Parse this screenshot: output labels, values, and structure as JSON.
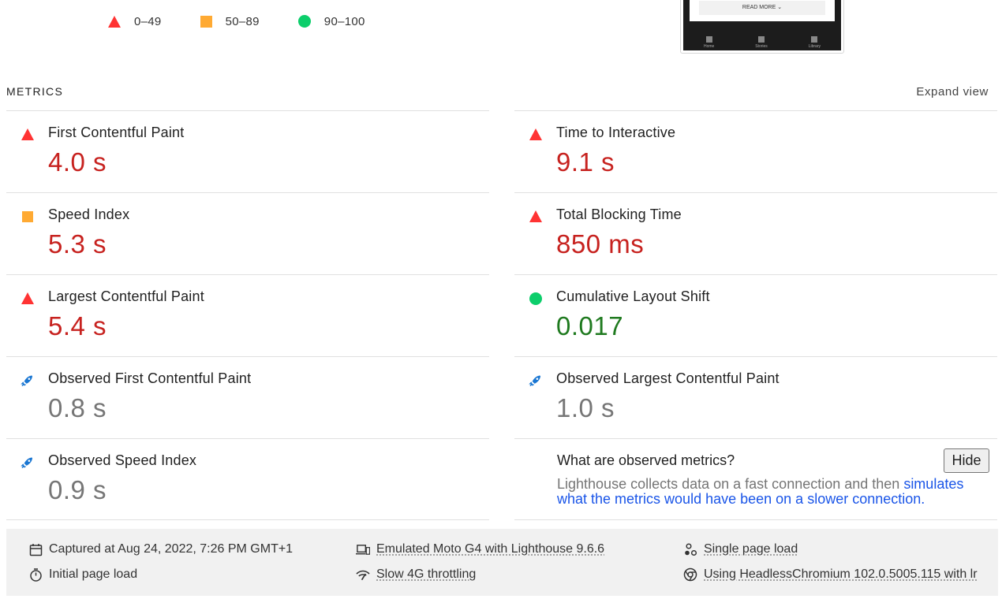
{
  "legend": [
    {
      "shape": "triangle",
      "color": "#ff3333",
      "label": "0–49"
    },
    {
      "shape": "square",
      "color": "#ffaa33",
      "label": "50–89"
    },
    {
      "shape": "circle",
      "color": "#0cce6b",
      "label": "90–100"
    }
  ],
  "screenshot_thumb": {
    "button_label": "READ MORE",
    "nav_items": [
      "Home",
      "Stories",
      "Library"
    ]
  },
  "metrics_header": {
    "title": "METRICS",
    "expand_label": "Expand view"
  },
  "metrics": [
    {
      "title": "First Contentful Paint",
      "value": "4.0 s",
      "rating": "fail"
    },
    {
      "title": "Time to Interactive",
      "value": "9.1 s",
      "rating": "fail"
    },
    {
      "title": "Speed Index",
      "value": "5.3 s",
      "rating": "average"
    },
    {
      "title": "Total Blocking Time",
      "value": "850 ms",
      "rating": "fail"
    },
    {
      "title": "Largest Contentful Paint",
      "value": "5.4 s",
      "rating": "fail"
    },
    {
      "title": "Cumulative Layout Shift",
      "value": "0.017",
      "rating": "pass"
    },
    {
      "title": "Observed First Contentful Paint",
      "value": "0.8 s",
      "rating": "informative"
    },
    {
      "title": "Observed Largest Contentful Paint",
      "value": "1.0 s",
      "rating": "informative"
    },
    {
      "title": "Observed Speed Index",
      "value": "0.9 s",
      "rating": "informative"
    }
  ],
  "observed_explainer": {
    "title": "What are observed metrics?",
    "hide_label": "Hide",
    "text_prefix": "Lighthouse collects data on a fast connection and then ",
    "link_text": "simulates what the metrics would have been on a slower connection."
  },
  "footer": {
    "captured": "Captured at Aug 24, 2022, 7:26 PM GMT+1",
    "device": "Emulated Moto G4 with Lighthouse 9.6.6",
    "load_type": "Single page load",
    "initial_load": "Initial page load",
    "throttling": "Slow 4G throttling",
    "browser": "Using HeadlessChromium 102.0.5005.115 with lr"
  },
  "colors": {
    "fail": "#c7221f",
    "average": "#ffaa33",
    "pass": "#1f7a1f",
    "informative": "#767676",
    "link": "#1a55e8"
  }
}
